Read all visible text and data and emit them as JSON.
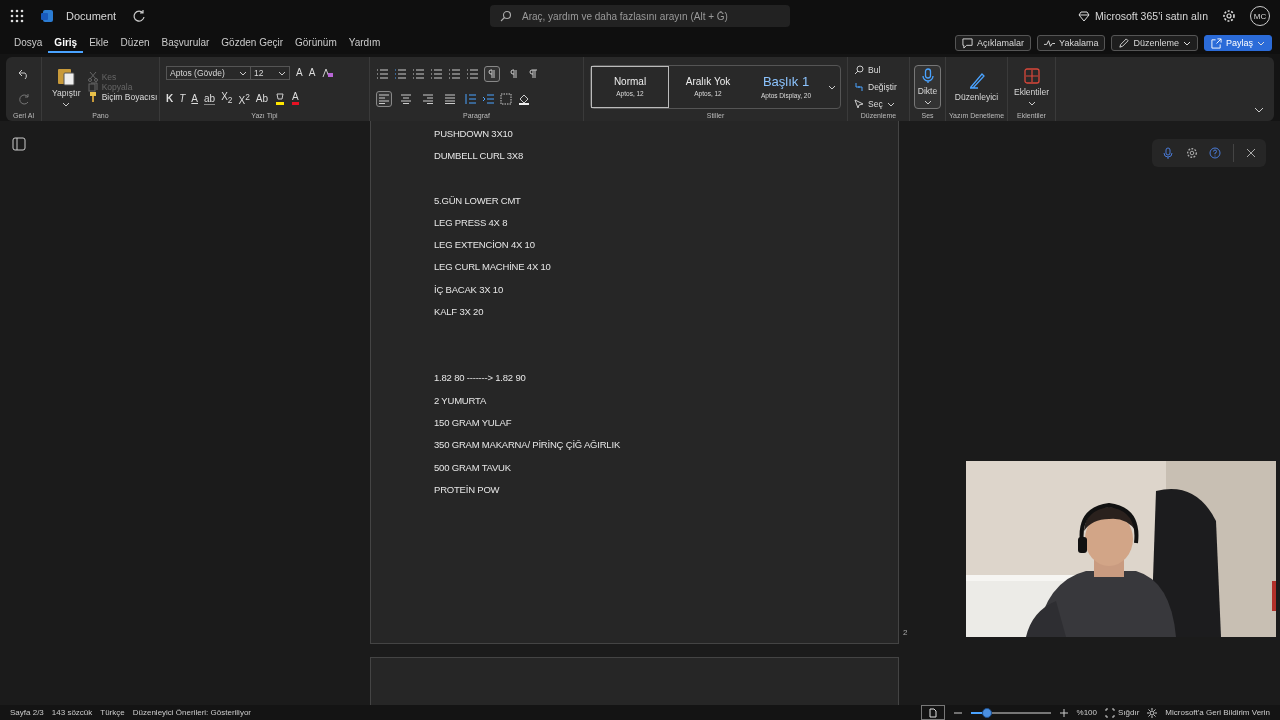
{
  "app": {
    "title": "Document",
    "search": {
      "placeholder": "Araç, yardım ve daha fazlasını arayın (Alt + Ğ)"
    },
    "buy": "Microsoft 365'i satın alın",
    "avatar": "MC"
  },
  "menu": {
    "tabs": [
      {
        "label": "Dosya",
        "selected": false
      },
      {
        "label": "Giriş",
        "selected": true
      },
      {
        "label": "Ekle",
        "selected": false
      },
      {
        "label": "Düzen",
        "selected": false
      },
      {
        "label": "Başvurular",
        "selected": false
      },
      {
        "label": "Gözden Geçir",
        "selected": false
      },
      {
        "label": "Görünüm",
        "selected": false
      },
      {
        "label": "Yardım",
        "selected": false
      }
    ],
    "actions": [
      {
        "label": "Açıklamalar",
        "kind": "comments"
      },
      {
        "label": "Yakalama",
        "kind": "catchup"
      },
      {
        "label": "Düzenleme",
        "kind": "editing"
      },
      {
        "label": "Paylaş",
        "kind": "share"
      }
    ]
  },
  "ribbon": {
    "undo": {
      "label": "Geri Al"
    },
    "clipboard": {
      "label": "Pano",
      "paste": "Yapıştır",
      "items": [
        {
          "label": "Kes",
          "kind": "cut",
          "disabled": true
        },
        {
          "label": "Kopyala",
          "kind": "copy",
          "disabled": true
        },
        {
          "label": "Biçim Boyacısı",
          "kind": "painter",
          "disabled": false
        }
      ]
    },
    "font": {
      "label": "Yazı Tipi",
      "family": "Aptos (Gövde)",
      "size": "12",
      "size_buttons": [
        "A",
        "A"
      ],
      "format_buttons": [
        {
          "label": "K",
          "kind": "bold"
        },
        {
          "label": "T",
          "kind": "italic"
        },
        {
          "label": "A",
          "kind": "underline"
        },
        {
          "label": "ab",
          "kind": "strike"
        },
        {
          "label": "X$_{2}$",
          "kind": "plain"
        },
        {
          "label": "X$^{2}$",
          "kind": "plain"
        },
        {
          "label": "Ab",
          "kind": "plain"
        }
      ],
      "font_color": "A"
    },
    "paragraph": {
      "label": "Paragraf",
      "directions": [
        {
          "selected": true
        },
        {
          "selected": false
        }
      ],
      "alignments": [
        {
          "selected": true
        },
        {
          "selected": false
        },
        {
          "selected": false
        },
        {
          "selected": false
        }
      ]
    },
    "styles": {
      "label": "Stiller",
      "items": [
        {
          "name": "Normal",
          "detail": "Aptos, 12",
          "kind": "normal",
          "selected": true
        },
        {
          "name": "Aralık Yok",
          "detail": "Aptos, 12",
          "kind": "normal",
          "selected": false
        },
        {
          "name": "Başlık 1",
          "detail": "Aptos Display, 20",
          "kind": "heading",
          "selected": false
        }
      ]
    },
    "editing": {
      "label": "Düzenleme",
      "items": [
        {
          "label": "Bul",
          "kind": "find"
        },
        {
          "label": "Değiştir",
          "kind": "replace"
        },
        {
          "label": "Seç",
          "kind": "select"
        }
      ]
    },
    "voice": {
      "label": "Ses",
      "button": "Dikte",
      "selected": true
    },
    "proofing": {
      "label": "Yazım Denetleme",
      "button": "Düzenleyici"
    },
    "addins": {
      "label": "Eklentiler",
      "button": "Eklentiler"
    }
  },
  "document": {
    "blocks": [
      {
        "lines": [
          "PUSHDOWN 3X10",
          "DUMBELL CURL 3X8"
        ]
      },
      {
        "lines": [
          "5.GÜN LOWER CMT",
          "LEG PRESS 4X 8",
          "LEG EXTENCİON 4X 10",
          "LEG CURL MACHİNE 4X 10",
          "İÇ BACAK 3X 10",
          "KALF 3X 20"
        ]
      },
      {
        "lines": [
          "1.82 80  -------> 1.82  90",
          "2 YUMURTA",
          "150 GRAM YULAF",
          "350 GRAM MAKARNA/ PİRİNÇ ÇİĞ AĞIRLIK",
          "500 GRAM TAVUK",
          "PROTEİN POW"
        ]
      }
    ],
    "page_number": "2"
  },
  "status": {
    "items": [
      "Sayfa 2/3",
      "143 sözcük",
      "Türkçe",
      "Düzenleyici Önerileri: Gösteriliyor"
    ],
    "zoom": {
      "level": 0.2,
      "percent": "%100"
    },
    "fit": "Sığdır",
    "feedback": "Microsoft'a Geri Bildirim Verin"
  }
}
